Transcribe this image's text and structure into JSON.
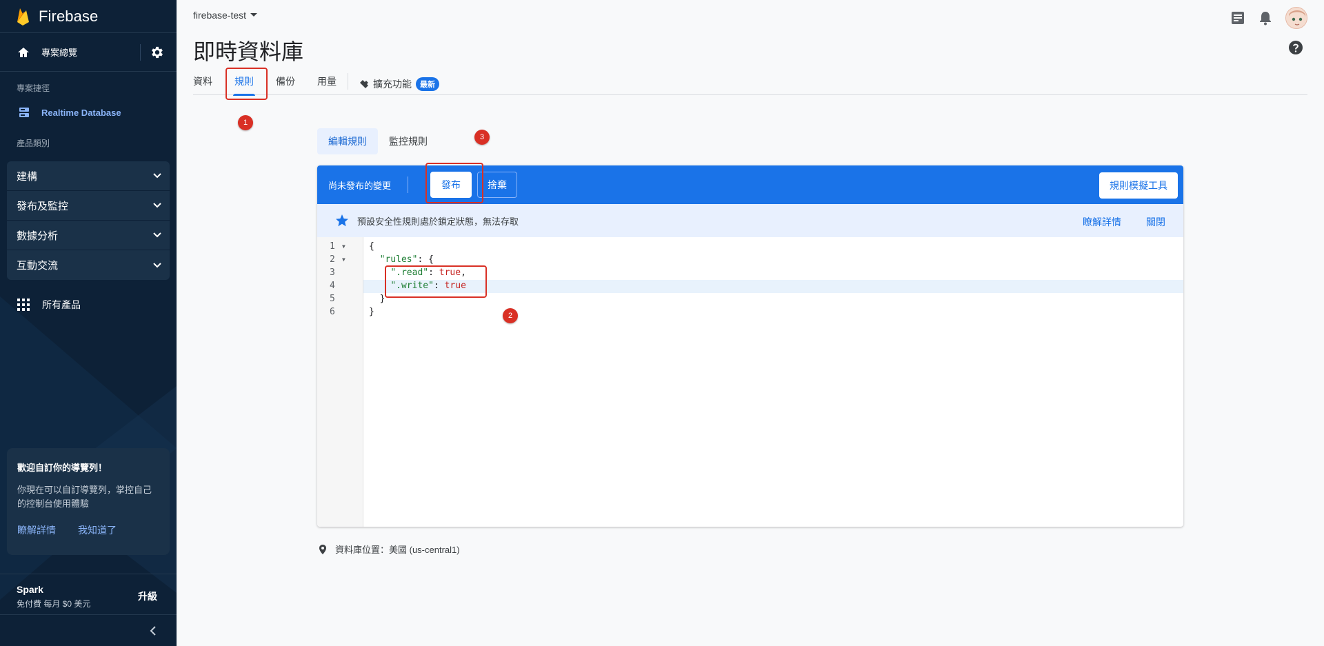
{
  "sidebar": {
    "brand": "Firebase",
    "overview_label": "專案總覽",
    "section_shortcuts": "專案捷徑",
    "shortcut_item": "Realtime Database",
    "section_categories": "產品類別",
    "groups": [
      {
        "label": "建構"
      },
      {
        "label": "發布及監控"
      },
      {
        "label": "數據分析"
      },
      {
        "label": "互動交流"
      }
    ],
    "all_products": "所有產品",
    "card": {
      "title": "歡迎自訂你的導覽列！",
      "body": "你現在可以自訂導覽列，掌控自己的控制台使用體驗",
      "learn_more": "瞭解詳情",
      "got_it": "我知道了"
    },
    "plan": {
      "name": "Spark",
      "detail": "免付費 每月 $0 美元",
      "upgrade": "升級"
    }
  },
  "header": {
    "project": "firebase-test",
    "page_title": "即時資料庫"
  },
  "tabs": [
    {
      "label": "資料",
      "active": false
    },
    {
      "label": "規則",
      "active": true
    },
    {
      "label": "備份",
      "active": false
    },
    {
      "label": "用量",
      "active": false
    }
  ],
  "extensions_tab": {
    "label": "擴充功能",
    "badge": "最新"
  },
  "subtabs": {
    "edit": "編輯規則",
    "monitor": "監控規則"
  },
  "toolbar": {
    "unsaved": "尚未發布的變更",
    "publish": "發布",
    "discard": "捨棄",
    "simulator": "規則模擬工具"
  },
  "info_bar": {
    "message": "預設安全性規則處於鎖定狀態，無法存取",
    "learn_more": "瞭解詳情",
    "close": "關閉"
  },
  "code": {
    "line_numbers": [
      "1",
      "2",
      "3",
      "4",
      "5",
      "6"
    ],
    "lines": [
      {
        "plain": "{"
      },
      {
        "indent": "  ",
        "key": "\"rules\"",
        "rest": ": {"
      },
      {
        "indent": "    ",
        "key": "\".read\"",
        "sep": ": ",
        "value": "true",
        "tail": ","
      },
      {
        "indent": "    ",
        "key": "\".write\"",
        "sep": ": ",
        "value": "true",
        "tail": ""
      },
      {
        "plain": "  }"
      },
      {
        "plain": "}"
      }
    ]
  },
  "annotations": [
    "1",
    "2",
    "3"
  ],
  "location": "資料庫位置：美國 (us-central1)",
  "colors": {
    "sidebar_bg": "#0d2137",
    "accent": "#1a73e8",
    "annotation": "#d93025"
  }
}
